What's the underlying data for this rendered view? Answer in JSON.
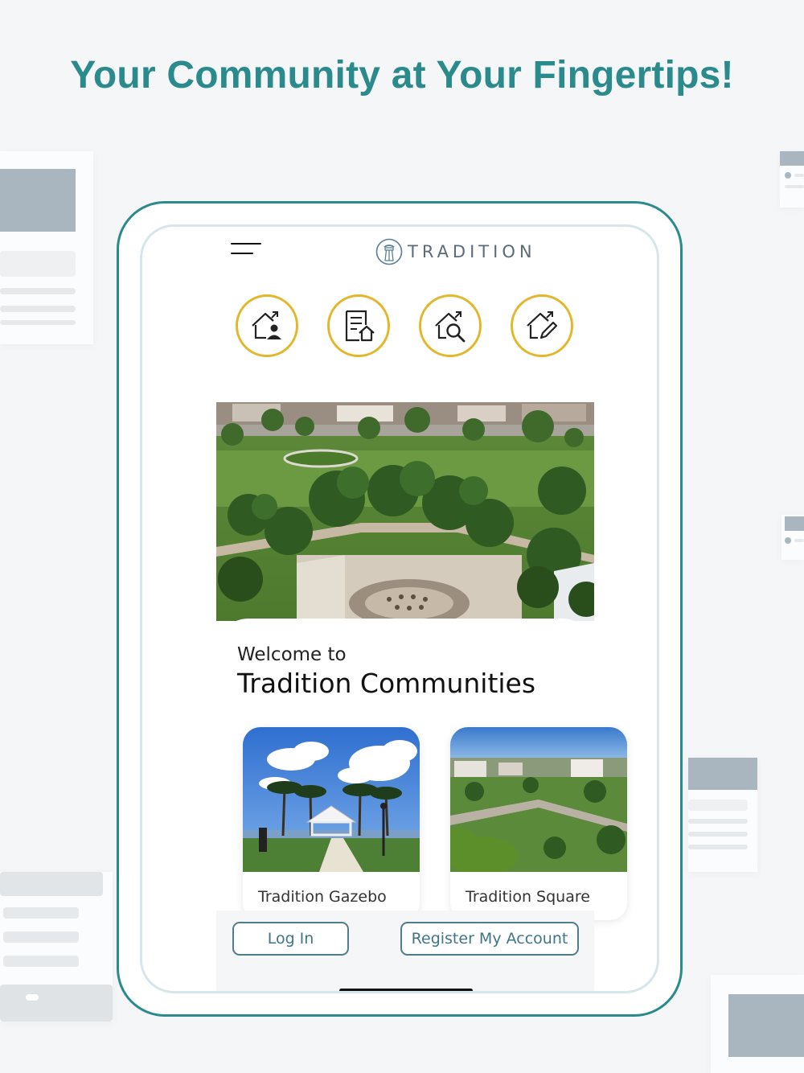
{
  "headline": "Your Community at Your Fingertips!",
  "header": {
    "logo_text": "TRADITION"
  },
  "quick_actions": [
    {
      "icon": "home-user-icon"
    },
    {
      "icon": "document-home-icon"
    },
    {
      "icon": "home-search-icon"
    },
    {
      "icon": "home-edit-icon"
    }
  ],
  "welcome": {
    "line1": "Welcome to",
    "line2": "Tradition Communities"
  },
  "places": [
    {
      "name": "Tradition Gazebo"
    },
    {
      "name": "Tradition Square"
    }
  ],
  "actions": {
    "login_label": "Log In",
    "register_label": "Register My Account"
  },
  "colors": {
    "accent": "#2a8a8c",
    "icon_ring": "#e3b72b",
    "button_text": "#3f7588"
  }
}
